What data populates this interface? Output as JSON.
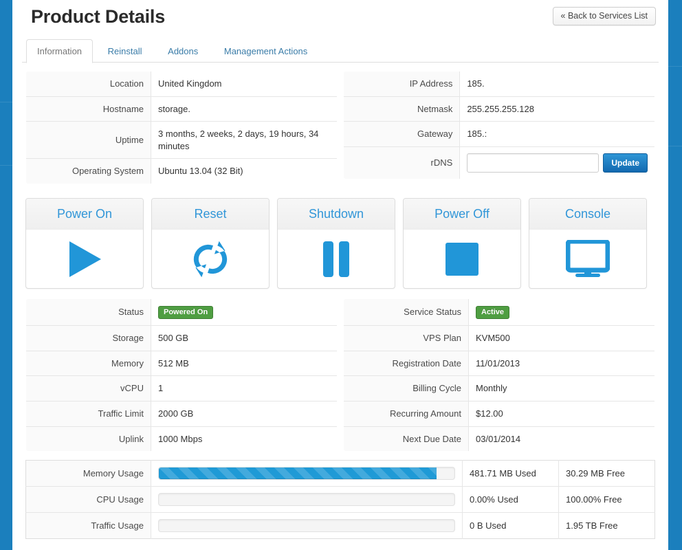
{
  "theme": {
    "accent_blue": "#1b7fbd",
    "icon_blue": "#3196d8",
    "badge_green": "#4f9e42",
    "link_blue": "#3a7ca8"
  },
  "header": {
    "title": "Product Details",
    "back_button": "« Back to Services List"
  },
  "tabs": [
    {
      "label": "Information",
      "active": true
    },
    {
      "label": "Reinstall",
      "active": false
    },
    {
      "label": "Addons",
      "active": false
    },
    {
      "label": "Management Actions",
      "active": false
    }
  ],
  "server_info": {
    "rows": [
      {
        "label": "Location",
        "value": "United Kingdom"
      },
      {
        "label": "Hostname",
        "value": "storage."
      },
      {
        "label": "Uptime",
        "value": "3 months, 2 weeks, 2 days, 19 hours, 34 minutes"
      },
      {
        "label": "Operating System",
        "value": "Ubuntu 13.04 (32 Bit)"
      }
    ]
  },
  "network_info": {
    "rows": [
      {
        "label": "IP Address",
        "value": "185."
      },
      {
        "label": "Netmask",
        "value": "255.255.255.128"
      },
      {
        "label": "Gateway",
        "value": "185.:"
      }
    ],
    "rdns": {
      "label": "rDNS",
      "value": "",
      "placeholder": "",
      "update_button": "Update"
    }
  },
  "power_actions": [
    {
      "label": "Power On",
      "icon": "play-icon"
    },
    {
      "label": "Reset",
      "icon": "refresh-icon"
    },
    {
      "label": "Shutdown",
      "icon": "pause-icon"
    },
    {
      "label": "Power Off",
      "icon": "stop-icon"
    },
    {
      "label": "Console",
      "icon": "monitor-icon"
    }
  ],
  "vps_specs": {
    "rows": [
      {
        "label": "Status",
        "value": "Powered On",
        "type": "badge"
      },
      {
        "label": "Storage",
        "value": "500 GB",
        "type": "text"
      },
      {
        "label": "Memory",
        "value": "512 MB",
        "type": "text"
      },
      {
        "label": "vCPU",
        "value": "1",
        "type": "text"
      },
      {
        "label": "Traffic Limit",
        "value": "2000 GB",
        "type": "text"
      },
      {
        "label": "Uplink",
        "value": "1000 Mbps",
        "type": "text"
      }
    ]
  },
  "billing_info": {
    "rows": [
      {
        "label": "Service Status",
        "value": "Active",
        "type": "badge"
      },
      {
        "label": "VPS Plan",
        "value": "KVM500",
        "type": "text"
      },
      {
        "label": "Registration Date",
        "value": "11/01/2013",
        "type": "text"
      },
      {
        "label": "Billing Cycle",
        "value": "Monthly",
        "type": "text"
      },
      {
        "label": "Recurring Amount",
        "value": "$12.00",
        "type": "text"
      },
      {
        "label": "Next Due Date",
        "value": "03/01/2014",
        "type": "text"
      }
    ]
  },
  "usage": {
    "rows": [
      {
        "label": "Memory Usage",
        "percent": 94,
        "used": "481.71 MB Used",
        "free": "30.29 MB Free"
      },
      {
        "label": "CPU Usage",
        "percent": 0,
        "used": "0.00% Used",
        "free": "100.00% Free"
      },
      {
        "label": "Traffic Usage",
        "percent": 0,
        "used": "0 B Used",
        "free": "1.95 TB Free"
      }
    ]
  }
}
